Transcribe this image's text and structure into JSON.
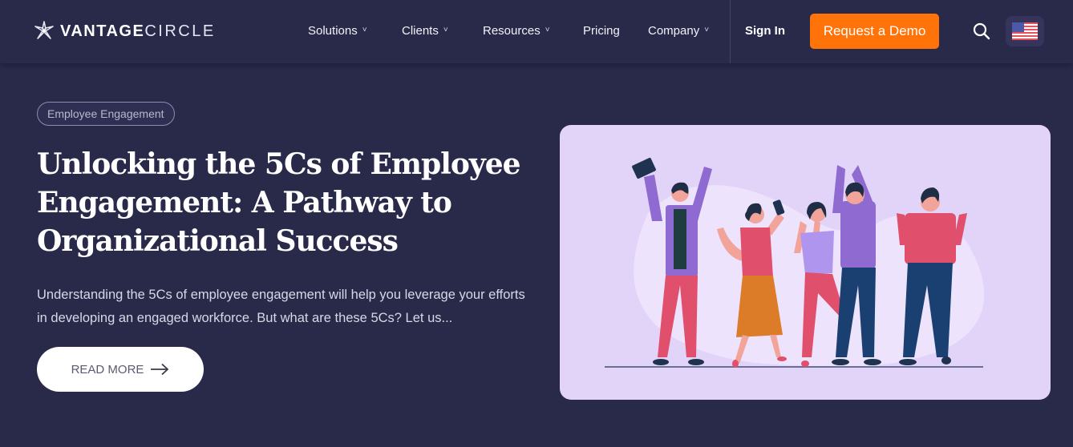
{
  "header": {
    "logo": {
      "bold": "VANTAGE",
      "light": "CIRCLE",
      "icon": "star-flower-icon"
    },
    "nav": [
      {
        "label": "Solutions",
        "has_dropdown": true
      },
      {
        "label": "Clients",
        "has_dropdown": true
      },
      {
        "label": "Resources",
        "has_dropdown": true
      },
      {
        "label": "Pricing",
        "has_dropdown": false
      },
      {
        "label": "Company",
        "has_dropdown": true
      }
    ],
    "chevron": "˅",
    "sign_in": "Sign In",
    "cta": "Request a Demo",
    "search_icon": "search-icon",
    "locale_icon": "us-flag-icon"
  },
  "hero": {
    "category": "Employee Engagement",
    "title": "Unlocking the 5Cs of Employee Engagement: A Pathway to Organizational Success",
    "excerpt": "Understanding the 5Cs of employee engagement will help you leverage your efforts in developing an engaged workforce. But what are these 5Cs? Let us...",
    "read_more": "READ MORE",
    "image_alt": "Group of five people celebrating"
  },
  "colors": {
    "background": "#29294a",
    "accent": "#ff7308",
    "image_bg": "#e2d4f9"
  }
}
